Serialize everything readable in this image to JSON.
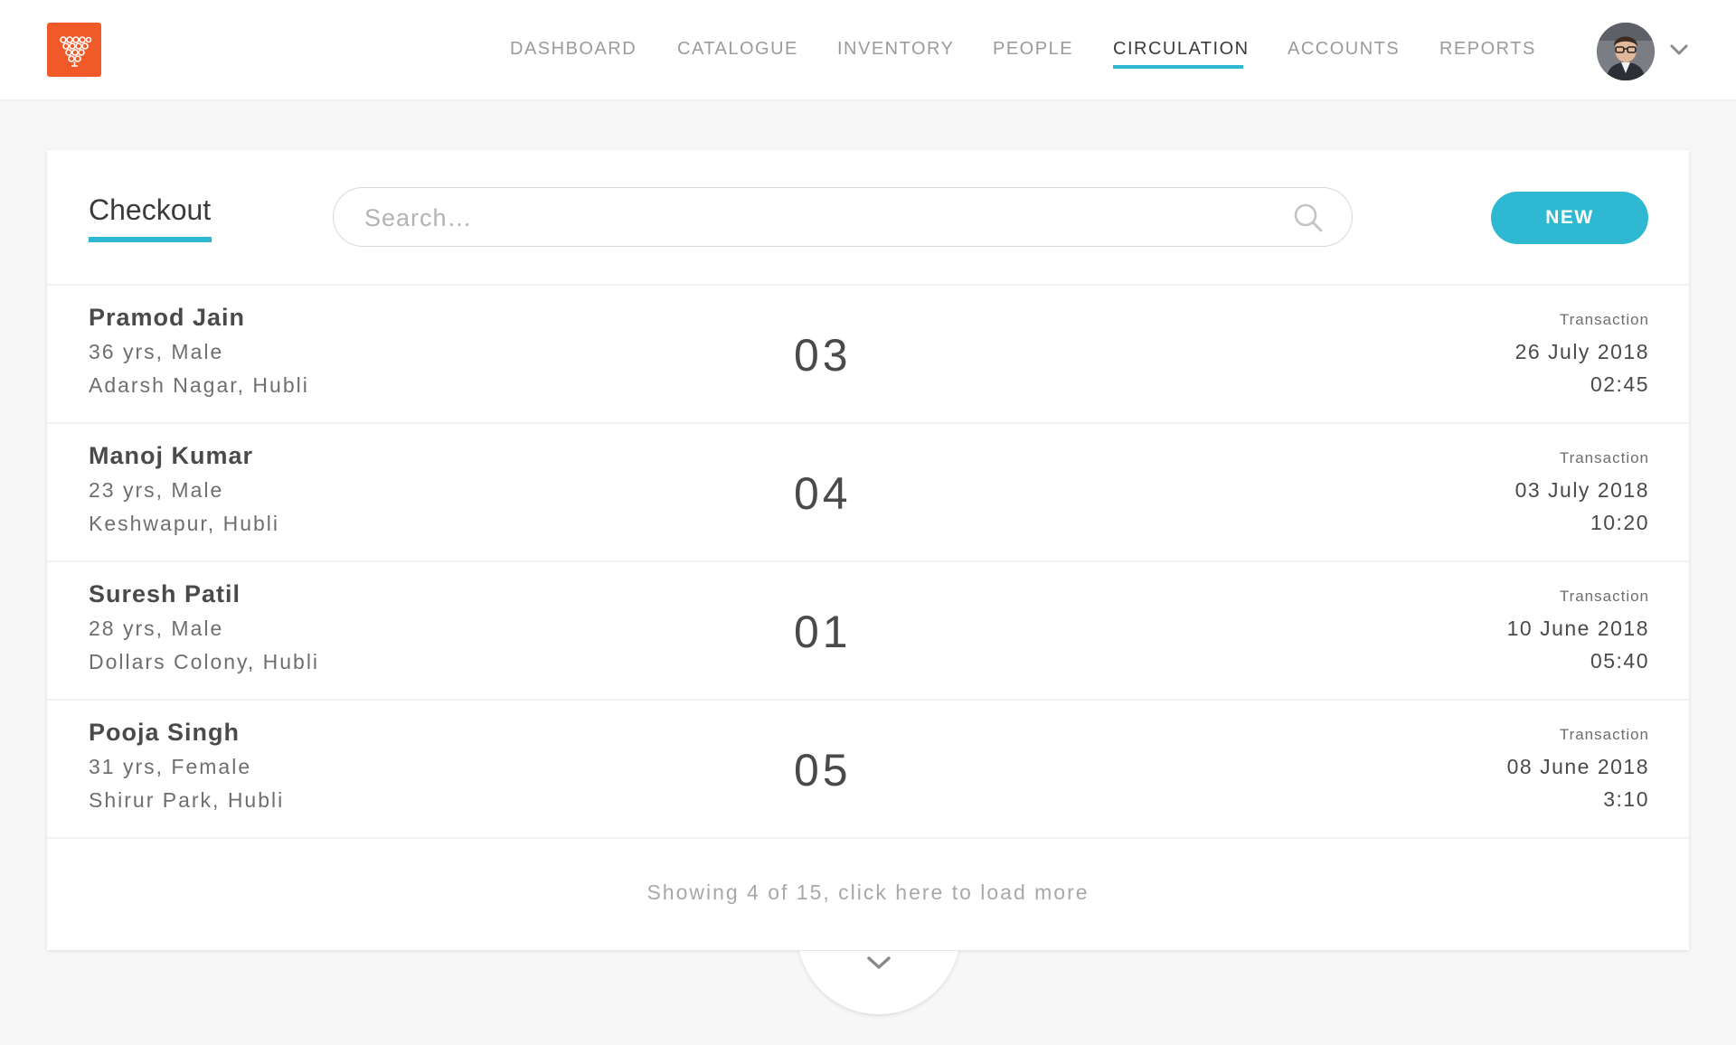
{
  "nav": {
    "items": [
      {
        "label": "DASHBOARD"
      },
      {
        "label": "CATALOGUE"
      },
      {
        "label": "INVENTORY"
      },
      {
        "label": "PEOPLE"
      },
      {
        "label": "CIRCULATION",
        "active": true
      },
      {
        "label": "ACCOUNTS"
      },
      {
        "label": "REPORTS"
      }
    ],
    "logo_icon": "library-logo-icon",
    "avatar_icon": "user-avatar",
    "menu_icon": "chevron-down-icon"
  },
  "checkout": {
    "title": "Checkout",
    "search_placeholder": "Search…",
    "search_icon": "search-icon",
    "new_label": "NEW"
  },
  "transactions": [
    {
      "name": "Pramod Jain",
      "meta": "36 yrs, Male",
      "address": "Adarsh Nagar, Hubli",
      "count": "03",
      "label": "Transaction",
      "date": "26 July 2018",
      "time": "02:45"
    },
    {
      "name": "Manoj Kumar",
      "meta": "23 yrs, Male",
      "address": "Keshwapur, Hubli",
      "count": "04",
      "label": "Transaction",
      "date": "03 July 2018",
      "time": "10:20"
    },
    {
      "name": "Suresh Patil",
      "meta": "28 yrs, Male",
      "address": "Dollars Colony, Hubli",
      "count": "01",
      "label": "Transaction",
      "date": "10 June 2018",
      "time": "05:40"
    },
    {
      "name": "Pooja Singh",
      "meta": "31 yrs, Female",
      "address": "Shirur Park, Hubli",
      "count": "05",
      "label": "Transaction",
      "date": "08 June 2018",
      "time": "3:10"
    }
  ],
  "pagination": {
    "load_more_text": "Showing 4 of 15, click here to load more",
    "load_more_icon": "chevron-down-icon"
  },
  "colors": {
    "accent": "#2eb8d2",
    "logo": "#f05a28",
    "background": "#f7f7f7"
  }
}
